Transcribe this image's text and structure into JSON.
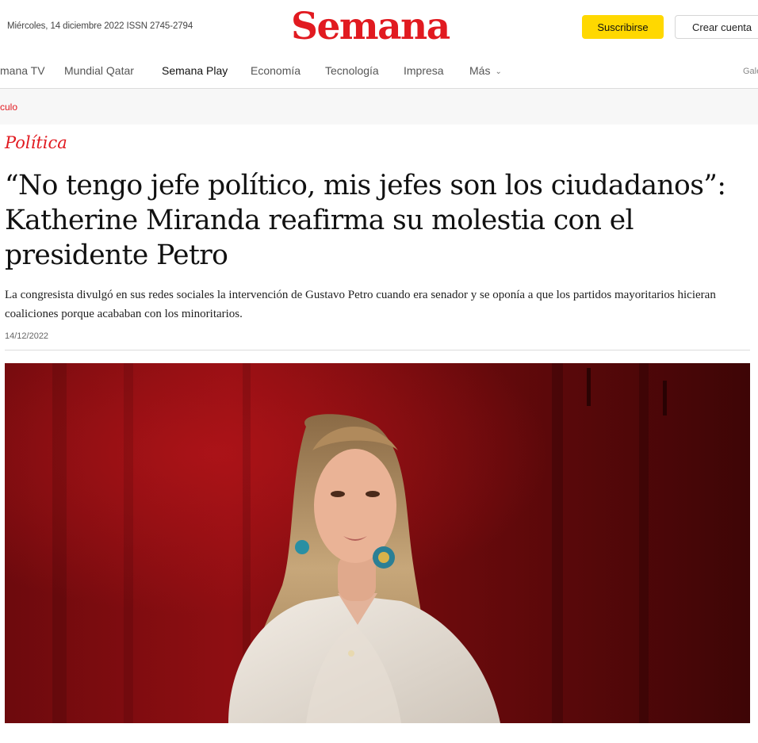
{
  "header": {
    "dateline": "Miércoles, 14 diciembre 2022 ISSN 2745-2794",
    "logo": "Semana",
    "subscribe_label": "Suscribirse",
    "create_account_label": "Crear cuenta"
  },
  "nav": {
    "items": [
      {
        "label": "mana TV"
      },
      {
        "label": "Mundial Qatar"
      },
      {
        "label": "Semana Play"
      },
      {
        "label": "Economía"
      },
      {
        "label": "Tecnología"
      },
      {
        "label": "Impresa"
      },
      {
        "label": "Más"
      }
    ],
    "extra": "Gale"
  },
  "breadcrumb": "culo",
  "article": {
    "section": "Política",
    "headline": "“No tengo jefe político, mis jefes son los ciudadanos”: Katherine Miranda reafirma su molestia con el presidente Petro",
    "lede": "La congresista divulgó en sus redes sociales la intervención de Gustavo Petro cuando era senador y se oponía a que los partidos mayoritarios hicieran coaliciones porque acababan con los minoritarios.",
    "date": "14/12/2022"
  },
  "colors": {
    "brand_red": "#e11a20",
    "subscribe_yellow": "#ffd800"
  }
}
